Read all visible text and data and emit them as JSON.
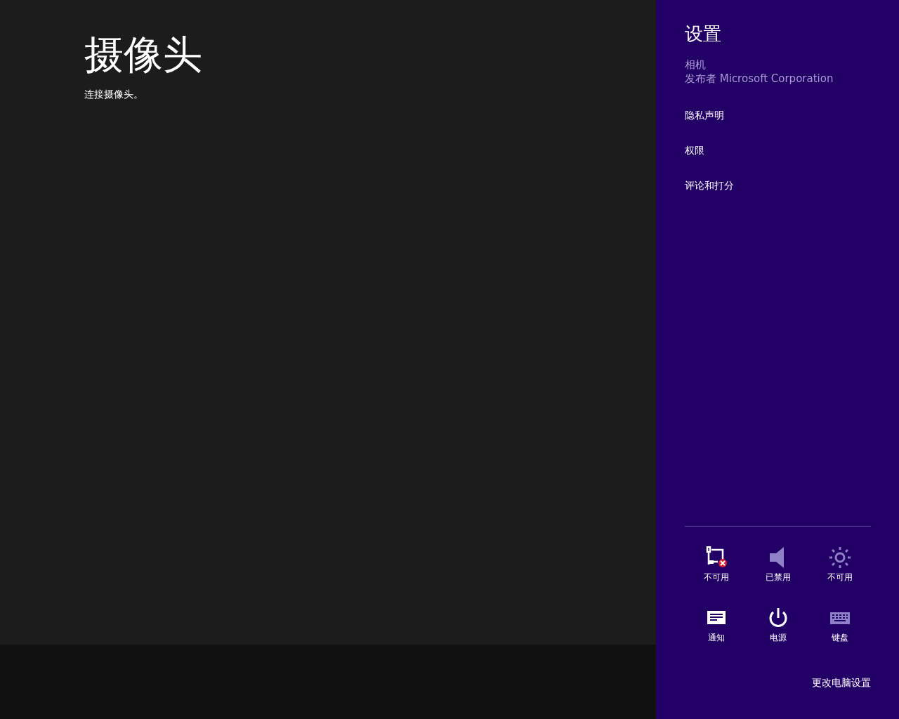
{
  "app": {
    "title": "摄像头",
    "message": "连接摄像头。"
  },
  "settings": {
    "title": "设置",
    "app_name": "相机",
    "publisher": "发布者 Microsoft Corporation",
    "links": [
      "隐私声明",
      "权限",
      "评论和打分"
    ],
    "tiles": [
      {
        "kind": "network",
        "label": "不可用",
        "disabled": false
      },
      {
        "kind": "volume",
        "label": "已禁用",
        "disabled": true
      },
      {
        "kind": "brightness",
        "label": "不可用",
        "disabled": true
      },
      {
        "kind": "notifications",
        "label": "通知",
        "disabled": false
      },
      {
        "kind": "power",
        "label": "电源",
        "disabled": false
      },
      {
        "kind": "keyboard",
        "label": "键盘",
        "disabled": true
      }
    ],
    "footer_link": "更改电脑设置"
  }
}
